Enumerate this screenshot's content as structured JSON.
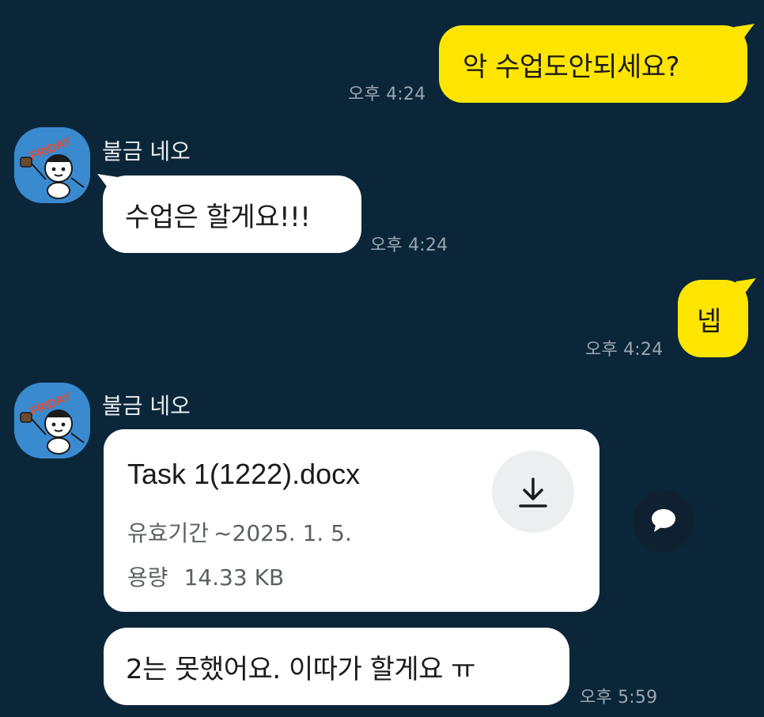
{
  "messages": {
    "m1": {
      "text": "악 수업도안되세요?",
      "time": "오후 4:24"
    },
    "m2": {
      "sender": "불금 네오",
      "text": "수업은 할게요!!!",
      "time": "오후 4:24"
    },
    "m3": {
      "text": "넵",
      "time": "오후 4:24"
    },
    "m4": {
      "sender": "불금 네오",
      "file": {
        "name": "Task 1(1222).docx",
        "expiry_label": "유효기간",
        "expiry_value": "~2025. 1. 5.",
        "size_label": "용량",
        "size_value": "14.33 KB"
      }
    },
    "m5": {
      "text": "2는 못했어요. 이따가 할게요 ㅠ",
      "time": "오후 5:59"
    }
  },
  "avatar": {
    "badge_text": "FRIDAY"
  },
  "icons": {
    "download": "download-icon",
    "reply": "speech-bubble-icon"
  },
  "colors": {
    "background": "#0b2639",
    "my_bubble": "#fee500",
    "their_bubble": "#ffffff"
  }
}
